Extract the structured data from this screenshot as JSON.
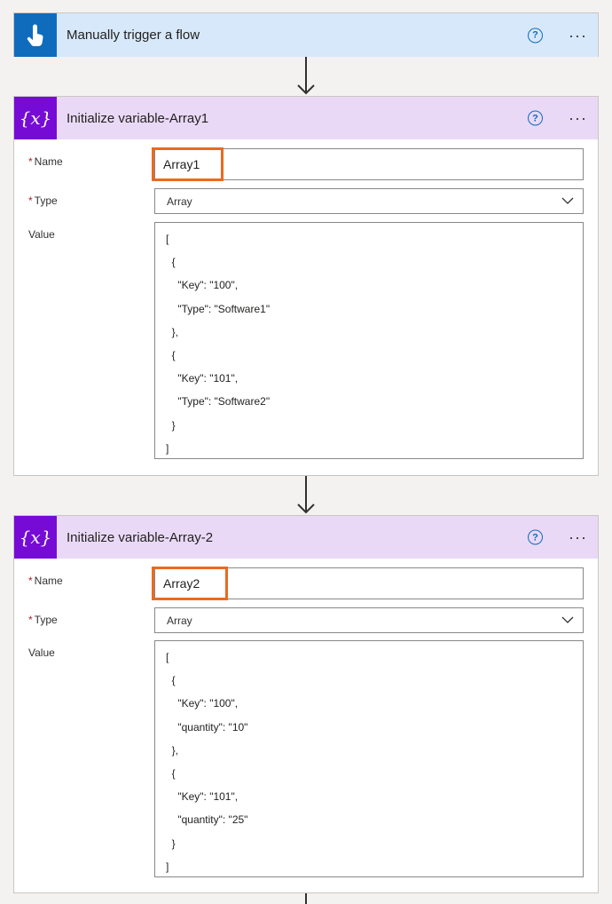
{
  "trigger": {
    "title": "Manually trigger a flow",
    "help": "?",
    "more": "···"
  },
  "labels": {
    "name": "Name",
    "type": "Type",
    "value": "Value",
    "required_mark": "*"
  },
  "actions": [
    {
      "title": "Initialize variable-Array1",
      "name": "Array1",
      "type": "Array",
      "value_lines": [
        "[",
        "  {",
        "    \"Key\": \"100\",",
        "    \"Type\": \"Software1\"",
        "  },",
        "  {",
        "    \"Key\": \"101\",",
        "    \"Type\": \"Software2\"",
        "  }",
        "]"
      ]
    },
    {
      "title": "Initialize variable-Array-2",
      "name": "Array2",
      "type": "Array",
      "value_lines": [
        "[",
        "  {",
        "    \"Key\": \"100\",",
        "    \"quantity\": \"10\"",
        "  },",
        "  {",
        "    \"Key\": \"101\",",
        "    \"quantity\": \"25\"",
        "  }",
        "]"
      ]
    }
  ],
  "colors": {
    "trigger_accent": "#0f6cbd",
    "variable_accent": "#770bd6",
    "highlight": "#ea6a1f"
  },
  "icons": {
    "trigger": "touch-hand-icon",
    "variable": "variable-x-icon",
    "help": "help-circle-icon",
    "more": "more-ellipsis-icon",
    "chevron": "chevron-down-icon",
    "arrow": "arrow-down-icon"
  }
}
